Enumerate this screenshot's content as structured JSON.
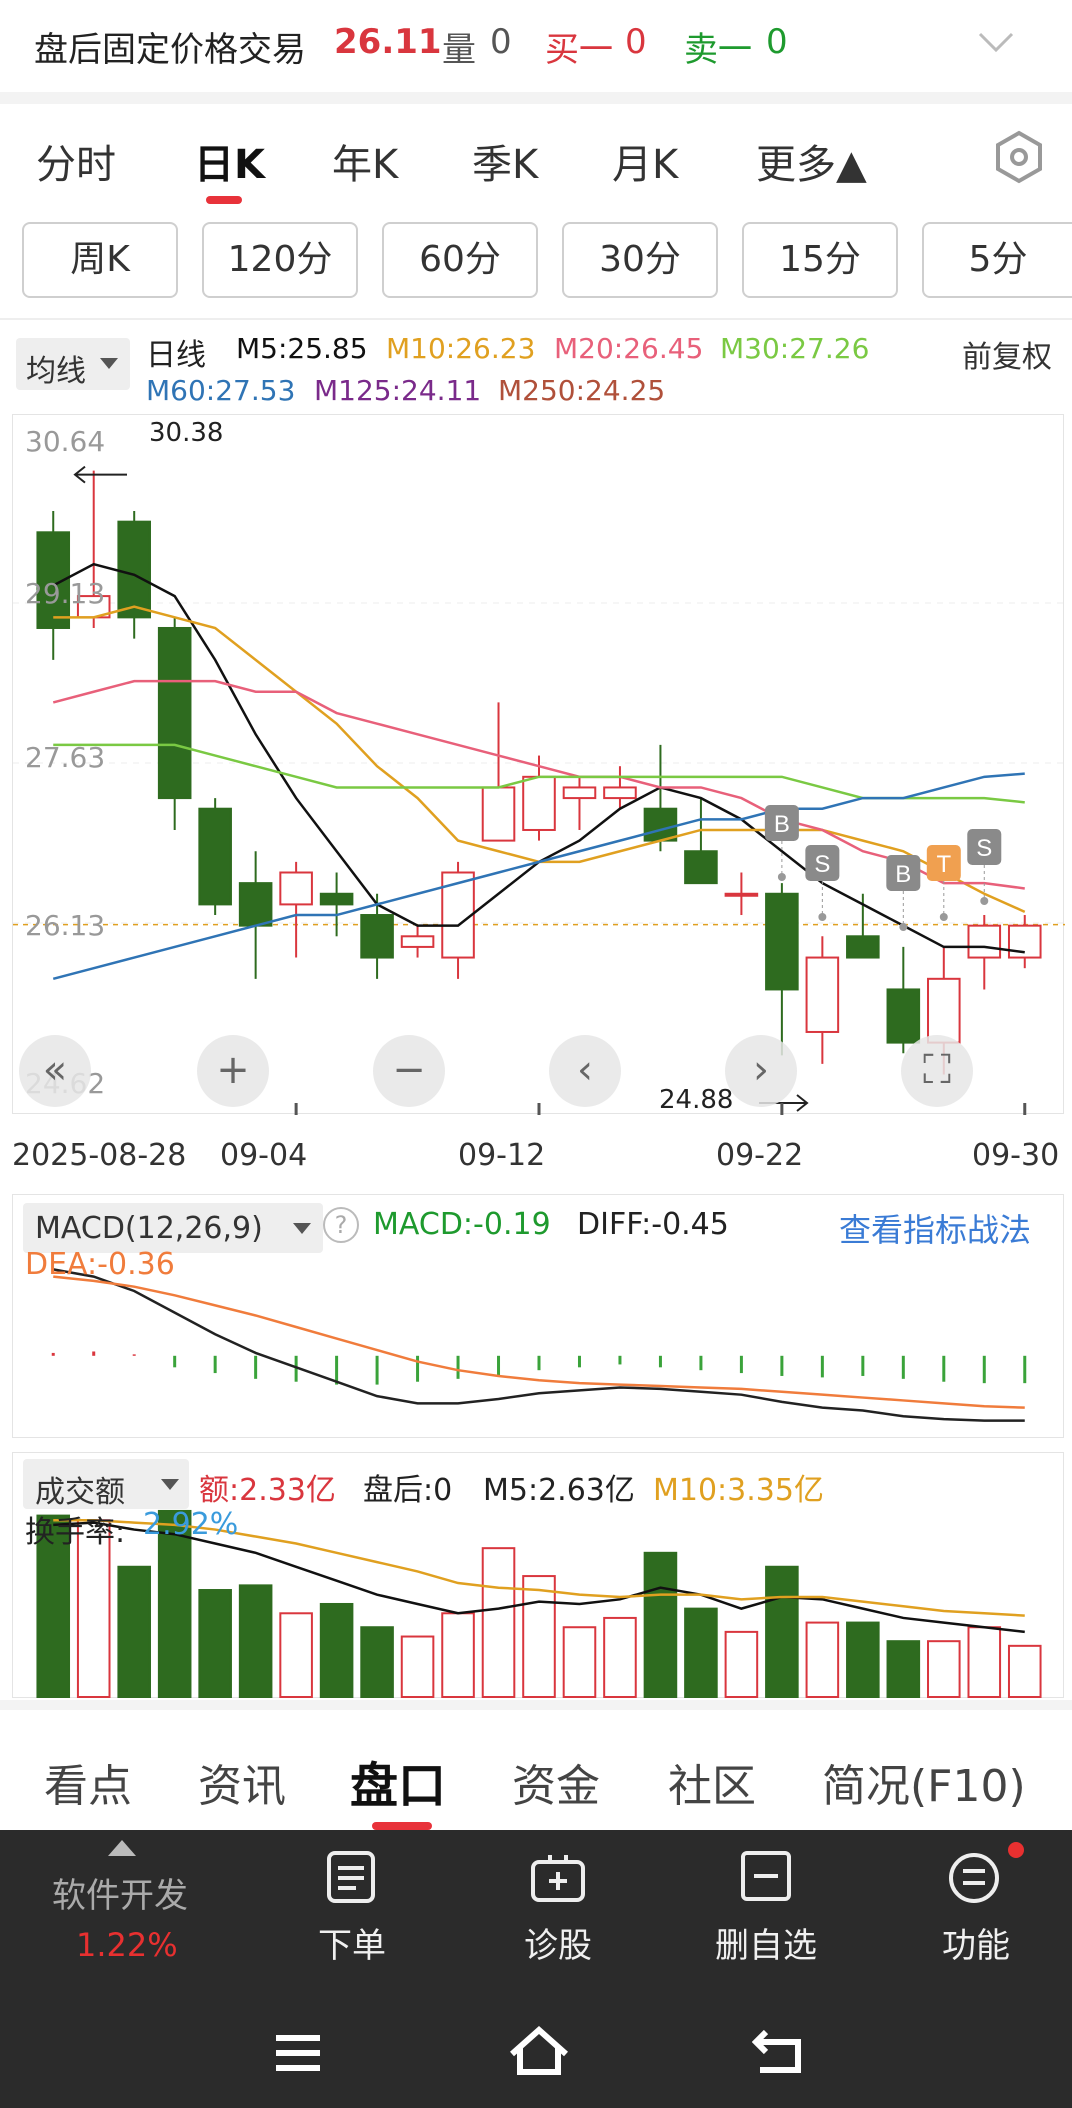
{
  "header": {
    "title": "盘后固定价格交易",
    "price": "26.11",
    "volume_label": "量",
    "volume_value": "0",
    "bid1_label": "买一",
    "bid1_value": "0",
    "ask1_label": "卖一",
    "ask1_value": "0"
  },
  "period_tabs": [
    {
      "label": "分时"
    },
    {
      "label": "日K"
    },
    {
      "label": "年K"
    },
    {
      "label": "季K"
    },
    {
      "label": "月K"
    },
    {
      "label": "更多▲"
    }
  ],
  "minute_pills": [
    {
      "label": "周K"
    },
    {
      "label": "120分"
    },
    {
      "label": "60分"
    },
    {
      "label": "30分"
    },
    {
      "label": "15分"
    },
    {
      "label": "5分"
    }
  ],
  "ma": {
    "selector": "均线",
    "period": "日线",
    "m5": "M5:25.85",
    "m10": "M10:26.23",
    "m20": "M20:26.45",
    "m30": "M30:27.26",
    "m60": "M60:27.53",
    "m125": "M125:24.11",
    "m250": "M250:24.25",
    "adjust": "前复权"
  },
  "price_axis": {
    "labels": [
      "30.64",
      "29.13",
      "27.63",
      "26.13",
      "24.62"
    ],
    "high_marker": "30.38",
    "low_marker": "24.88"
  },
  "date_axis": {
    "labels": [
      "2025-08-28",
      "09-04",
      "09-12",
      "09-22",
      "09-30"
    ]
  },
  "trade_markers": [
    "B",
    "S",
    "B",
    "T",
    "S"
  ],
  "macd": {
    "selector": "MACD(12,26,9)",
    "help": "?",
    "macd": "MACD:-0.19",
    "diff": "DIFF:-0.45",
    "dea": "DEA:-0.36",
    "link": "查看指标战法"
  },
  "volume": {
    "selector": "成交额",
    "amount": "额:2.33亿",
    "after_hours": "盘后:0",
    "m5": "M5:2.63亿",
    "m10": "M10:3.35亿",
    "turnover_label": "换手率:",
    "turnover_value": "2.92%"
  },
  "bottom_tabs": [
    {
      "label": "看点"
    },
    {
      "label": "资讯"
    },
    {
      "label": "盘口"
    },
    {
      "label": "资金"
    },
    {
      "label": "社区"
    },
    {
      "label": "简况(F10)"
    }
  ],
  "bottom_bar": {
    "sector_name": "软件开发",
    "sector_change": "1.22%",
    "order": "下单",
    "diagnose": "诊股",
    "remove_watch": "删自选",
    "functions": "功能"
  },
  "colors": {
    "up": "#d9363e",
    "down": "#2e6b1f",
    "m5": "#111111",
    "m10": "#e0a020",
    "m20": "#e8607a",
    "m30": "#7ac943",
    "m60": "#2f74b5",
    "m125": "#7a2a8a",
    "m250": "#b0503a",
    "dea": "#f07c3c",
    "turnover": "#3a9bdc",
    "link": "#3a7bd5"
  },
  "chart_data": {
    "type": "candlestick",
    "x": [
      "2025-08-27",
      "2025-08-28",
      "2025-08-29",
      "2025-09-01",
      "2025-09-02",
      "2025-09-03",
      "2025-09-04",
      "2025-09-05",
      "2025-09-08",
      "2025-09-09",
      "2025-09-10",
      "2025-09-11",
      "2025-09-12",
      "2025-09-15",
      "2025-09-16",
      "2025-09-17",
      "2025-09-18",
      "2025-09-19",
      "2025-09-22",
      "2025-09-23",
      "2025-09-24",
      "2025-09-25",
      "2025-09-26",
      "2025-09-29",
      "2025-09-30"
    ],
    "ohlc": [
      [
        29.8,
        30.0,
        28.6,
        28.9
      ],
      [
        29.0,
        30.38,
        28.9,
        29.2
      ],
      [
        29.9,
        30.0,
        28.8,
        29.0
      ],
      [
        28.9,
        29.0,
        27.0,
        27.3
      ],
      [
        27.2,
        27.3,
        26.2,
        26.3
      ],
      [
        26.5,
        26.8,
        25.6,
        26.1
      ],
      [
        26.3,
        26.7,
        25.8,
        26.6
      ],
      [
        26.4,
        26.6,
        26.0,
        26.3
      ],
      [
        26.2,
        26.4,
        25.6,
        25.8
      ],
      [
        25.9,
        26.1,
        25.8,
        26.0
      ],
      [
        25.8,
        26.7,
        25.6,
        26.6
      ],
      [
        26.9,
        28.2,
        26.9,
        27.4
      ],
      [
        27.0,
        27.7,
        26.9,
        27.5
      ],
      [
        27.3,
        27.5,
        27.0,
        27.4
      ],
      [
        27.3,
        27.6,
        27.2,
        27.4
      ],
      [
        27.2,
        27.8,
        26.8,
        26.9
      ],
      [
        26.8,
        27.3,
        26.5,
        26.5
      ],
      [
        26.4,
        26.6,
        26.2,
        26.4
      ],
      [
        26.4,
        26.5,
        24.88,
        25.5
      ],
      [
        25.1,
        26.0,
        24.8,
        25.8
      ],
      [
        26.0,
        26.4,
        25.8,
        25.8
      ],
      [
        25.5,
        25.9,
        24.9,
        25.0
      ],
      [
        25.0,
        25.9,
        24.7,
        25.6
      ],
      [
        25.8,
        26.2,
        25.5,
        26.1
      ],
      [
        25.8,
        26.2,
        25.7,
        26.1
      ]
    ],
    "ma_series": [
      {
        "name": "M5",
        "values": [
          29.3,
          29.5,
          29.4,
          29.2,
          28.6,
          27.9,
          27.3,
          26.8,
          26.3,
          26.1,
          26.1,
          26.4,
          26.7,
          26.9,
          27.2,
          27.4,
          27.3,
          27.1,
          26.8,
          26.5,
          26.3,
          26.1,
          25.9,
          25.9,
          25.85
        ]
      },
      {
        "name": "M10",
        "values": [
          29.0,
          29.0,
          29.1,
          29.0,
          28.9,
          28.6,
          28.3,
          28.0,
          27.6,
          27.3,
          26.9,
          26.8,
          26.7,
          26.7,
          26.8,
          26.9,
          27.0,
          27.0,
          27.0,
          27.0,
          26.9,
          26.8,
          26.6,
          26.4,
          26.23
        ]
      },
      {
        "name": "M20",
        "values": [
          28.2,
          28.3,
          28.4,
          28.4,
          28.4,
          28.3,
          28.3,
          28.1,
          28.0,
          27.9,
          27.8,
          27.7,
          27.6,
          27.5,
          27.5,
          27.4,
          27.4,
          27.3,
          27.1,
          27.0,
          26.8,
          26.7,
          26.5,
          26.5,
          26.45
        ]
      },
      {
        "name": "M30",
        "values": [
          27.8,
          27.8,
          27.8,
          27.8,
          27.7,
          27.6,
          27.5,
          27.4,
          27.4,
          27.4,
          27.4,
          27.4,
          27.5,
          27.5,
          27.5,
          27.5,
          27.5,
          27.5,
          27.5,
          27.4,
          27.3,
          27.3,
          27.3,
          27.3,
          27.26
        ]
      },
      {
        "name": "M60",
        "values": [
          25.6,
          25.7,
          25.8,
          25.9,
          26.0,
          26.1,
          26.2,
          26.2,
          26.3,
          26.4,
          26.5,
          26.6,
          26.7,
          26.8,
          26.9,
          27.0,
          27.1,
          27.1,
          27.2,
          27.2,
          27.3,
          27.3,
          27.4,
          27.5,
          27.53
        ]
      }
    ],
    "ylim": [
      24.62,
      30.64
    ],
    "macd": {
      "hist": [
        0.02,
        0.03,
        0.01,
        -0.08,
        -0.12,
        -0.16,
        -0.18,
        -0.2,
        -0.2,
        -0.18,
        -0.16,
        -0.14,
        -0.1,
        -0.08,
        -0.06,
        -0.08,
        -0.1,
        -0.12,
        -0.14,
        -0.15,
        -0.14,
        -0.16,
        -0.18,
        -0.19,
        -0.19
      ],
      "diff": [
        0.6,
        0.55,
        0.45,
        0.3,
        0.15,
        0.02,
        -0.08,
        -0.18,
        -0.28,
        -0.33,
        -0.33,
        -0.3,
        -0.26,
        -0.24,
        -0.22,
        -0.23,
        -0.25,
        -0.27,
        -0.32,
        -0.36,
        -0.38,
        -0.42,
        -0.44,
        -0.45,
        -0.45
      ],
      "dea": [
        0.55,
        0.52,
        0.48,
        0.42,
        0.35,
        0.28,
        0.2,
        0.12,
        0.04,
        -0.04,
        -0.1,
        -0.14,
        -0.17,
        -0.19,
        -0.2,
        -0.21,
        -0.22,
        -0.23,
        -0.25,
        -0.27,
        -0.29,
        -0.31,
        -0.33,
        -0.35,
        -0.36
      ]
    },
    "amount": {
      "values": [
        3.9,
        3.8,
        2.8,
        4.0,
        2.3,
        2.4,
        1.8,
        2.0,
        1.5,
        1.3,
        1.8,
        3.2,
        2.6,
        1.5,
        1.7,
        3.1,
        1.9,
        1.4,
        2.8,
        1.6,
        1.6,
        1.2,
        1.2,
        1.5,
        1.1
      ],
      "ma5": [
        3.7,
        3.75,
        3.6,
        3.5,
        3.3,
        3.1,
        2.8,
        2.5,
        2.2,
        2.0,
        1.8,
        1.9,
        2.05,
        2.0,
        2.1,
        2.35,
        2.2,
        1.9,
        2.15,
        2.1,
        1.9,
        1.7,
        1.6,
        1.5,
        1.4
      ],
      "ma10": [
        3.8,
        3.8,
        3.75,
        3.7,
        3.6,
        3.45,
        3.3,
        3.1,
        2.9,
        2.7,
        2.45,
        2.35,
        2.3,
        2.2,
        2.15,
        2.2,
        2.2,
        2.1,
        2.15,
        2.15,
        2.05,
        1.95,
        1.85,
        1.8,
        1.75
      ]
    }
  }
}
